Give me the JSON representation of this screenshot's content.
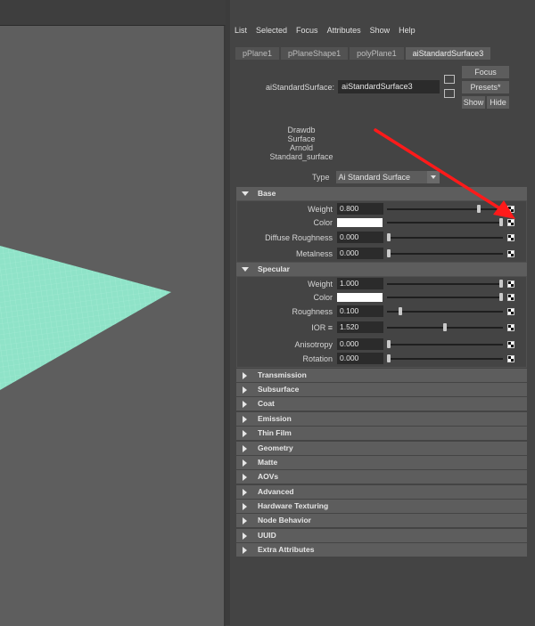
{
  "menu": [
    "List",
    "Selected",
    "Focus",
    "Attributes",
    "Show",
    "Help"
  ],
  "tabs": [
    "pPlane1",
    "pPlaneShape1",
    "polyPlane1",
    "aiStandardSurface3"
  ],
  "node": {
    "label": "aiStandardSurface:",
    "value": "aiStandardSurface3"
  },
  "buttons": {
    "focus": "Focus",
    "presets": "Presets*",
    "show": "Show",
    "hide": "Hide"
  },
  "classification": [
    "Drawdb",
    "Surface",
    "Arnold",
    "Standard_surface"
  ],
  "type": {
    "label": "Type",
    "value": "Ai Standard Surface"
  },
  "base": {
    "title": "Base",
    "weight": {
      "label": "Weight",
      "value": "0.800",
      "slider": 0.8
    },
    "color": {
      "label": "Color",
      "swatch": "#ffffff",
      "slider": 1.0
    },
    "diffuse_roughness": {
      "label": "Diffuse Roughness",
      "value": "0.000",
      "slider": 0.0
    },
    "metalness": {
      "label": "Metalness",
      "value": "0.000",
      "slider": 0.0
    }
  },
  "specular": {
    "title": "Specular",
    "weight": {
      "label": "Weight",
      "value": "1.000",
      "slider": 1.0
    },
    "color": {
      "label": "Color",
      "swatch": "#ffffff",
      "slider": 1.0
    },
    "roughness": {
      "label": "Roughness",
      "value": "0.100",
      "slider": 0.1
    },
    "ior": {
      "label": "IOR ≡",
      "value": "1.520",
      "slider": 0.5
    },
    "anisotropy": {
      "label": "Anisotropy",
      "value": "0.000",
      "slider": 0.0
    },
    "rotation": {
      "label": "Rotation",
      "value": "0.000",
      "slider": 0.0
    }
  },
  "collapsed_sections": [
    "Transmission",
    "Subsurface",
    "Coat",
    "Emission",
    "Thin Film",
    "Geometry",
    "Matte",
    "AOVs",
    "Advanced",
    "Hardware Texturing",
    "Node Behavior",
    "UUID",
    "Extra Attributes"
  ],
  "colors": {
    "plane": "#8fe3c8",
    "arrow": "#ff1a1a",
    "panel_bg": "#444444",
    "section_bg": "#5d5d5d"
  }
}
